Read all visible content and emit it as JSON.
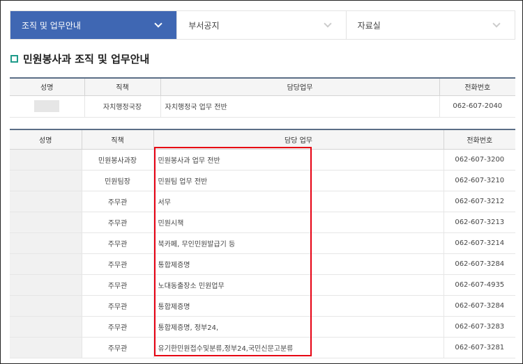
{
  "nav": {
    "items": [
      {
        "label": "조직 및 업무안내"
      },
      {
        "label": "부서공지"
      },
      {
        "label": "자료실"
      }
    ],
    "active_color": "#3f67b3"
  },
  "page_title": "민원봉사과 조직 및 업무안내",
  "table1": {
    "headers": [
      "성명",
      "직책",
      "담당업무",
      "전화번호"
    ],
    "rows": [
      {
        "name": "",
        "position": "자치행정국장",
        "duty": "자치행정국 업무 전반",
        "phone": "062-607-2040"
      }
    ]
  },
  "table2": {
    "headers": [
      "성명",
      "직책",
      "담당 업무",
      "전화번호"
    ],
    "rows": [
      {
        "name": "",
        "position": "민원봉사과장",
        "duty": "민원봉사과 업무 전반",
        "phone": "062-607-3200"
      },
      {
        "name": "",
        "position": "민원팀장",
        "duty": "민원팀 업무 전반",
        "phone": "062-607-3210"
      },
      {
        "name": "",
        "position": "주무관",
        "duty": "서무",
        "phone": "062-607-3212"
      },
      {
        "name": "",
        "position": "주무관",
        "duty": "민원시책",
        "phone": "062-607-3213"
      },
      {
        "name": "",
        "position": "주무관",
        "duty": "북카페, 무인민원발급기 등",
        "phone": "062-607-3214"
      },
      {
        "name": "",
        "position": "주무관",
        "duty": "통합제증명",
        "phone": "062-607-3284"
      },
      {
        "name": "",
        "position": "주무관",
        "duty": "노대동출장소 민원업무",
        "phone": "062-607-4935"
      },
      {
        "name": "",
        "position": "주무관",
        "duty": "통합제증명",
        "phone": "062-607-3284"
      },
      {
        "name": "",
        "position": "주무관",
        "duty": "통합제증명, 정부24,",
        "phone": "062-607-3283"
      },
      {
        "name": "",
        "position": "주무관",
        "duty": "유기한민원접수및분류,정부24,국민신문고분류",
        "phone": "062-607-3281"
      }
    ]
  },
  "highlight_color": "#e60012"
}
